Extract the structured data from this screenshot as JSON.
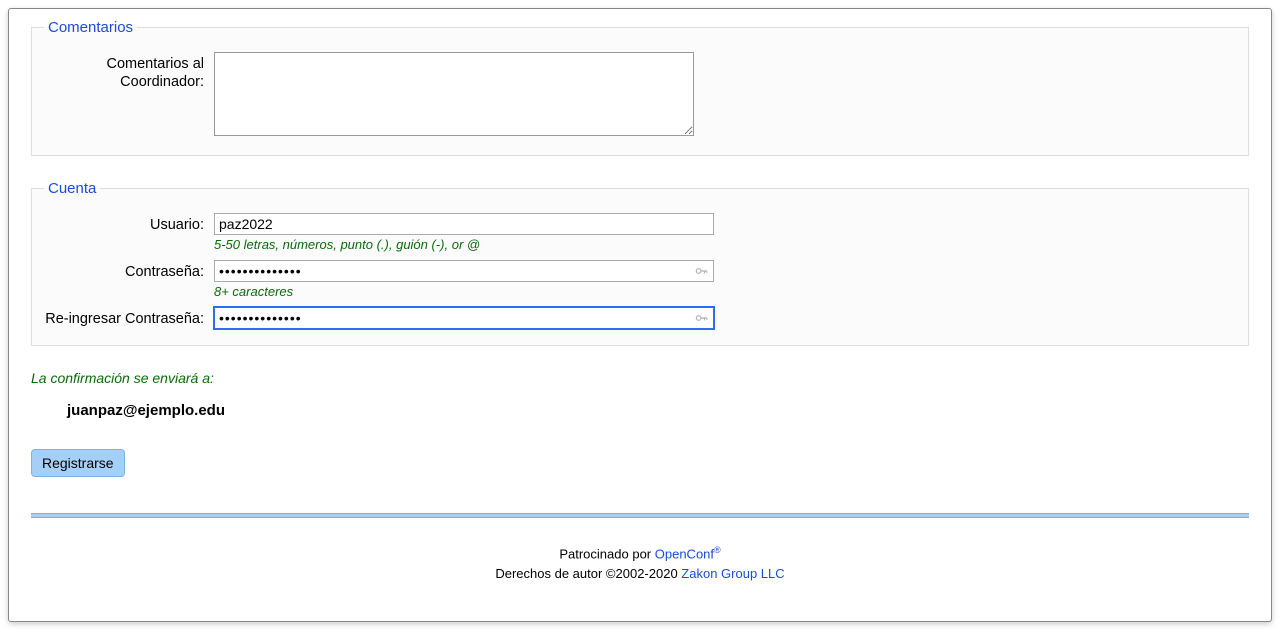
{
  "comentarios": {
    "legend": "Comentarios",
    "label": "Comentarios al Coordinador:",
    "value": ""
  },
  "cuenta": {
    "legend": "Cuenta",
    "usuario": {
      "label": "Usuario:",
      "value": "paz2022",
      "hint": "5-50 letras, números, punto (.), guión (-), or @"
    },
    "password": {
      "label": "Contraseña:",
      "value": "••••••••••••••",
      "hint": "8+ caracteres"
    },
    "password2": {
      "label": "Re-ingresar Contraseña:",
      "value": "••••••••••••••"
    }
  },
  "confirm": {
    "text": "La confirmación se enviará a:",
    "email": "juanpaz@ejemplo.edu"
  },
  "submit_label": "Registrarse",
  "footer": {
    "sponsored_prefix": "Patrocinado por ",
    "sponsored_link": "OpenConf",
    "sponsored_sup": "®",
    "copyright_prefix": "Derechos de autor ©2002-2020 ",
    "copyright_link": "Zakon Group LLC"
  }
}
